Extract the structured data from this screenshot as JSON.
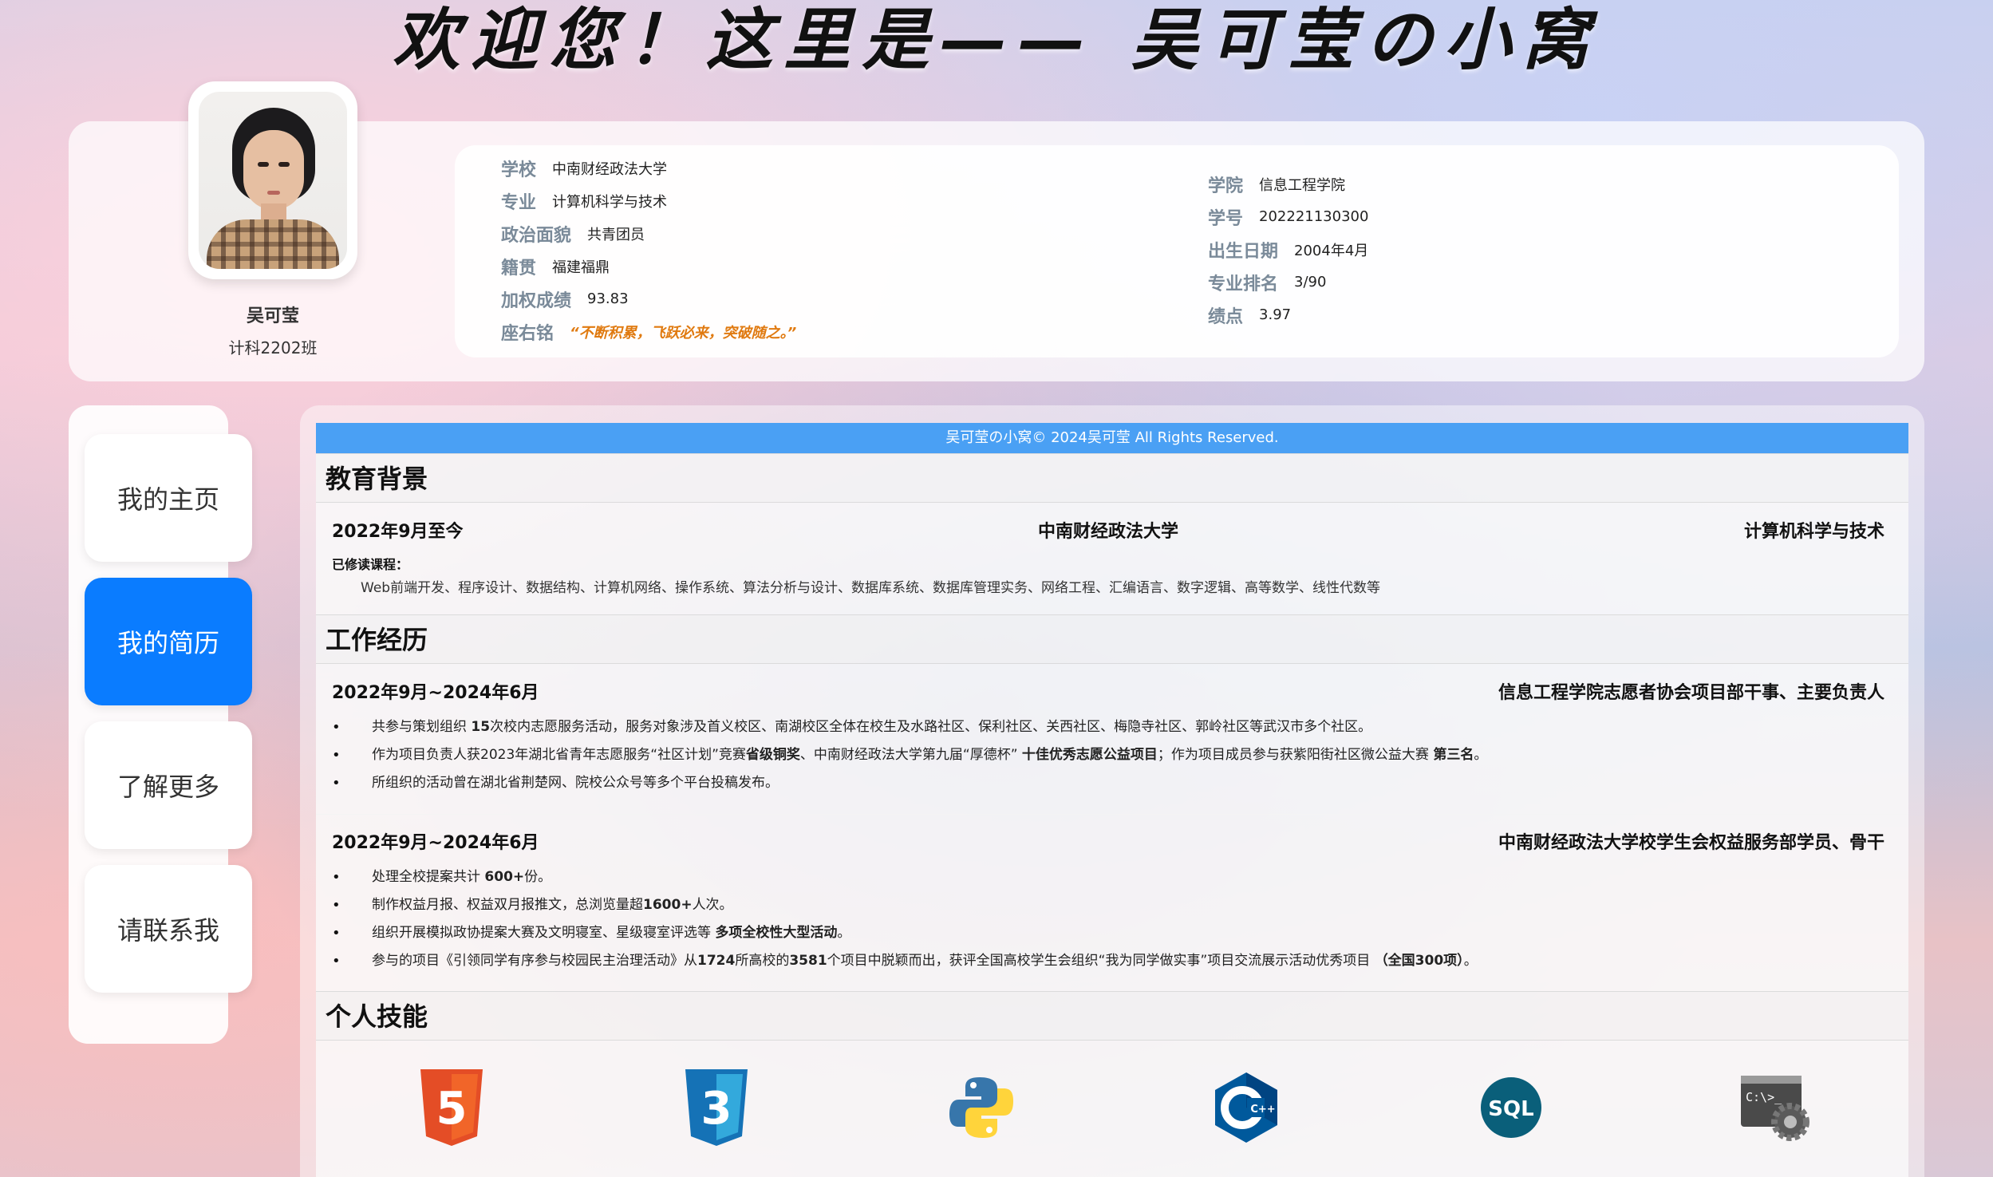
{
  "header": {
    "title": "欢迎您！这里是—— 吴可莹の小窝"
  },
  "profile": {
    "name": "吴可莹",
    "class": "计科2202班",
    "left": [
      {
        "k": "学校",
        "v": "中南财经政法大学"
      },
      {
        "k": "专业",
        "v": "计算机科学与技术"
      },
      {
        "k": "政治面貌",
        "v": "共青团员"
      },
      {
        "k": "籍贯",
        "v": "福建福鼎"
      },
      {
        "k": "加权成绩",
        "v": "93.83"
      },
      {
        "k": "座右铭",
        "v": "“不断积累，飞跃必来，突破随之。”"
      }
    ],
    "right": [
      {
        "k": "学院",
        "v": "信息工程学院"
      },
      {
        "k": "学号",
        "v": "202221130300"
      },
      {
        "k": "出生日期",
        "v": "2004年4月"
      },
      {
        "k": "专业排名",
        "v": "3/90"
      },
      {
        "k": "绩点",
        "v": "3.97"
      }
    ]
  },
  "nav": {
    "items": [
      {
        "label": "我的主页",
        "active": false
      },
      {
        "label": "我的简历",
        "active": true
      },
      {
        "label": "了解更多",
        "active": false
      },
      {
        "label": "请联系我",
        "active": false
      }
    ]
  },
  "main": {
    "banner": "吴可莹の小窝© 2024吴可莹 All Rights Reserved.",
    "education": {
      "heading": "教育背景",
      "period": "2022年9月至今",
      "school": "中南财经政法大学",
      "major": "计算机科学与技术",
      "courses_label": "已修读课程：",
      "courses": "Web前端开发、程序设计、数据结构、计算机网络、操作系统、算法分析与设计、数据库系统、数据库管理实务、网络工程、汇编语言、数字逻辑、高等数学、线性代数等"
    },
    "work": {
      "heading": "工作经历",
      "jobs": [
        {
          "period": "2022年9月~2024年6月",
          "role": "信息工程学院志愿者协会项目部干事、主要负责人",
          "bullets": [
            [
              "共参与策划组织 ",
              "15",
              "次校内志愿服务活动，服务对象涉及首义校区、南湖校区全体在校生及水路社区、保利社区、关西社区、梅隐寺社区、郭岭社区等武汉市多个社区。",
              "",
              ""
            ],
            [
              "作为项目负责人获2023年湖北省青年志愿服务“社区计划”竞赛",
              "省级铜奖",
              "、中南财经政法大学第九届“厚德杯” ",
              "十佳优秀志愿公益项目",
              "；作为项目成员参与获紫阳街社区微公益大赛 ",
              "第三名",
              "。"
            ],
            [
              "所组织的活动曾在湖北省荆楚网、院校公众号等多个平台投稿发布。",
              "",
              "",
              "",
              ""
            ]
          ]
        },
        {
          "period": "2022年9月~2024年6月",
          "role": "中南财经政法大学校学生会权益服务部学员、骨干",
          "bullets": [
            [
              "处理全校提案共计 ",
              "600+",
              "份。",
              "",
              ""
            ],
            [
              "制作权益月报、权益双月报推文，总浏览量超",
              "1600+",
              "人次。",
              "",
              ""
            ],
            [
              "组织开展模拟政协提案大赛及文明寝室、星级寝室评选等 ",
              "多项全校性大型活动",
              "。",
              "",
              ""
            ],
            [
              "参与的项目《引领同学有序参与校园民主治理活动》从",
              "1724",
              "所高校的",
              "3581",
              "个项目中脱颖而出，获评全国高校学生会组织“我为同学做实事”项目交流展示活动优秀项目 ",
              "（全国300项）",
              "。"
            ]
          ]
        }
      ]
    },
    "skills": {
      "heading": "个人技能",
      "icons": [
        {
          "name": "html5-icon",
          "label": "5",
          "color": "#e44d26"
        },
        {
          "name": "css3-icon",
          "label": "3",
          "color": "#1572b6"
        },
        {
          "name": "python-icon",
          "label": "",
          "color": "#3776ab"
        },
        {
          "name": "cpp-icon",
          "label": "C++",
          "color": "#00599c"
        },
        {
          "name": "sql-icon",
          "label": "SQL",
          "color": "#0a5f7a"
        },
        {
          "name": "terminal-settings-icon",
          "label": "C:\\>_",
          "color": "#555555"
        }
      ]
    }
  }
}
